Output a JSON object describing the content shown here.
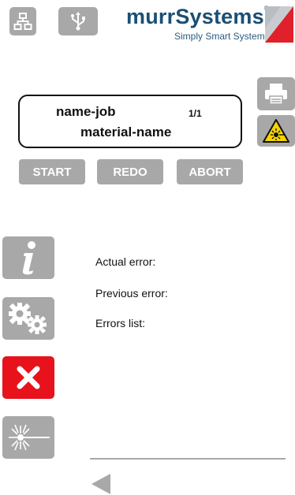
{
  "header": {
    "network_icon": "network-icon",
    "usb_icon": "usb-icon",
    "logo": {
      "brand_text": "murrSystems",
      "registered_mark": "®",
      "tagline": "Simply Smart Systems"
    }
  },
  "job": {
    "name": "name-job",
    "counter": "1/1",
    "material": "material-name"
  },
  "actions": {
    "start_label": "START",
    "redo_label": "REDO",
    "abort_label": "ABORT"
  },
  "side_icons": {
    "printer": "printer-icon",
    "laser_warning": "laser-warning-icon",
    "info": "info-icon",
    "settings": "gears-icon",
    "error": "close-icon",
    "laser": "laser-icon"
  },
  "errors": {
    "actual_label": "Actual error:",
    "previous_label": "Previous error:",
    "list_label": "Errors list:"
  },
  "footer": {
    "back_icon": "back-arrow-icon"
  },
  "colors": {
    "button_gray": "#a8a8a8",
    "error_red": "#e8121d",
    "warning_yellow": "#f5d400",
    "logo_blue": "#1b4f75",
    "logo_red": "#e0202a"
  }
}
